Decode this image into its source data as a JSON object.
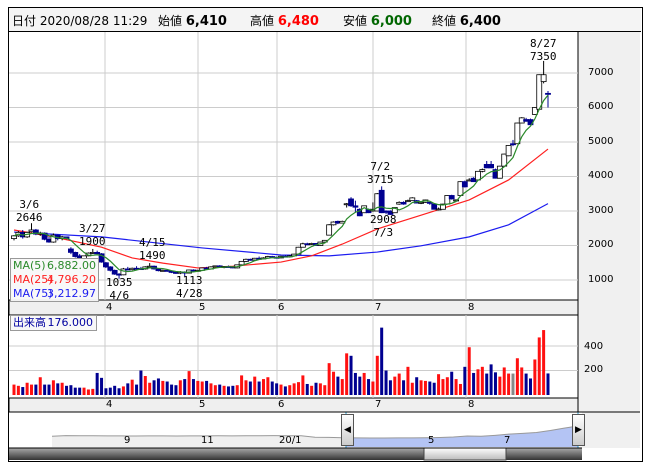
{
  "header": {
    "date_label": "日付",
    "date_value": "2020/08/28 11:29",
    "open_label": "始値",
    "open_value": "6,410",
    "high_label": "高値",
    "high_value": "6,480",
    "low_label": "安値",
    "low_value": "6,000",
    "close_label": "終値",
    "close_value": "6,400"
  },
  "legend": {
    "ma5_label": "MA(5)",
    "ma5_value": "6,882.00",
    "ma25_label": "MA(25)",
    "ma25_value": "4,796.20",
    "ma75_label": "MA(75)",
    "ma75_value": "3,212.97"
  },
  "volume_panel": {
    "label": "出来高",
    "value": "176.000",
    "ticks": [
      "400",
      "200"
    ]
  },
  "price_axis": {
    "ticks": [
      "7000",
      "6000",
      "5000",
      "4000",
      "3000",
      "2000",
      "1000"
    ]
  },
  "month_labels": [
    "4",
    "5",
    "6",
    "7",
    "8"
  ],
  "annotations": [
    {
      "date": "3/6",
      "value": "2646"
    },
    {
      "date": "3/27",
      "value": "1900"
    },
    {
      "date": "4/6",
      "value": "1035"
    },
    {
      "date": "4/15",
      "value": "1490"
    },
    {
      "date": "4/28",
      "value": "1113"
    },
    {
      "date": "7/2",
      "value": "3715"
    },
    {
      "date": "7/3",
      "value": "2908"
    },
    {
      "date": "8/27",
      "value": "7350"
    }
  ],
  "navigator": {
    "labels": [
      "9",
      "11",
      "20/1",
      "5",
      "7"
    ],
    "series": [
      2100,
      2350,
      2330,
      2300,
      2280,
      2250,
      2230,
      2250,
      2260,
      2240,
      2250,
      2280,
      2300,
      2260,
      2330,
      2320,
      2350,
      2340,
      2300,
      1700,
      1650,
      1500,
      1450,
      1400,
      1380,
      1420,
      1450,
      1500,
      1600,
      1800,
      2200,
      2100,
      2500,
      3000,
      3300,
      3700,
      4500,
      5500,
      6400
    ],
    "selected_from": 0.56
  },
  "colors": {
    "up_volume": "#ff1010",
    "down": "#000090",
    "ma5": "#2a8a2a",
    "ma25": "#ff2020",
    "ma75": "#1c1cf0",
    "nav_sel": "#b4c4f4"
  },
  "chart_data": {
    "type": "candlestick",
    "title": "",
    "price_ylim": [
      420,
      8130
    ],
    "volume_ylim": [
      0,
      645
    ],
    "month_start_index": {
      "4": 22,
      "5": 43,
      "6": 61,
      "7": 83,
      "8": 104
    },
    "ohlcv": [
      [
        2200,
        2300,
        2150,
        2280,
        85
      ],
      [
        2280,
        2420,
        2250,
        2380,
        75
      ],
      [
        2380,
        2450,
        2200,
        2250,
        65
      ],
      [
        2250,
        2400,
        2220,
        2380,
        100
      ],
      [
        2400,
        2646,
        2380,
        2450,
        85
      ],
      [
        2450,
        2480,
        2300,
        2330,
        85
      ],
      [
        2330,
        2400,
        2280,
        2360,
        145
      ],
      [
        2360,
        2380,
        2150,
        2180,
        85
      ],
      [
        2180,
        2250,
        2080,
        2100,
        85
      ],
      [
        2100,
        2350,
        2080,
        2300,
        120
      ],
      [
        2300,
        2320,
        2150,
        2200,
        95
      ],
      [
        2200,
        2280,
        2150,
        2250,
        100
      ],
      [
        2250,
        2260,
        2180,
        2200,
        75
      ],
      [
        1900,
        1950,
        1750,
        1800,
        80
      ],
      [
        1800,
        1820,
        1650,
        1680,
        60
      ],
      [
        1700,
        1750,
        1600,
        1620,
        60
      ],
      [
        1620,
        1700,
        1580,
        1700,
        60
      ],
      [
        1700,
        1800,
        1690,
        1780,
        45
      ],
      [
        1780,
        1900,
        1760,
        1800,
        50
      ],
      [
        1800,
        1850,
        1750,
        1760,
        180
      ],
      [
        1760,
        1780,
        1500,
        1520,
        140
      ],
      [
        1500,
        1520,
        1350,
        1380,
        55
      ],
      [
        1380,
        1400,
        1250,
        1280,
        60
      ],
      [
        1280,
        1300,
        1150,
        1170,
        75
      ],
      [
        1170,
        1200,
        1035,
        1150,
        55
      ],
      [
        1150,
        1350,
        1140,
        1320,
        70
      ],
      [
        1320,
        1380,
        1280,
        1300,
        95
      ],
      [
        1300,
        1360,
        1280,
        1340,
        125
      ],
      [
        1340,
        1400,
        1300,
        1330,
        85
      ],
      [
        1330,
        1380,
        1300,
        1320,
        200
      ],
      [
        1320,
        1400,
        1300,
        1380,
        155
      ],
      [
        1380,
        1490,
        1370,
        1400,
        100
      ],
      [
        1400,
        1420,
        1300,
        1320,
        120
      ],
      [
        1320,
        1340,
        1250,
        1270,
        135
      ],
      [
        1270,
        1300,
        1260,
        1280,
        115
      ],
      [
        1280,
        1300,
        1240,
        1260,
        110
      ],
      [
        1260,
        1280,
        1200,
        1220,
        85
      ],
      [
        1220,
        1250,
        1180,
        1200,
        80
      ],
      [
        1200,
        1260,
        1170,
        1230,
        120
      ],
      [
        1230,
        1250,
        1113,
        1200,
        130
      ],
      [
        1200,
        1300,
        1190,
        1290,
        195
      ],
      [
        1290,
        1310,
        1250,
        1260,
        130
      ],
      [
        1260,
        1300,
        1240,
        1280,
        115
      ],
      [
        1280,
        1360,
        1270,
        1350,
        110
      ],
      [
        1350,
        1380,
        1300,
        1320,
        115
      ],
      [
        1320,
        1400,
        1310,
        1380,
        95
      ],
      [
        1380,
        1420,
        1370,
        1410,
        80
      ],
      [
        1410,
        1430,
        1350,
        1370,
        85
      ],
      [
        1370,
        1400,
        1340,
        1390,
        75
      ],
      [
        1390,
        1420,
        1370,
        1380,
        70
      ],
      [
        1380,
        1400,
        1340,
        1350,
        75
      ],
      [
        1350,
        1450,
        1340,
        1440,
        80
      ],
      [
        1440,
        1550,
        1430,
        1540,
        160
      ],
      [
        1540,
        1620,
        1520,
        1600,
        120
      ],
      [
        1600,
        1620,
        1560,
        1580,
        110
      ],
      [
        1580,
        1640,
        1570,
        1630,
        150
      ],
      [
        1630,
        1680,
        1600,
        1620,
        110
      ],
      [
        1620,
        1660,
        1600,
        1640,
        130
      ],
      [
        1640,
        1700,
        1630,
        1680,
        145
      ],
      [
        1680,
        1700,
        1650,
        1660,
        110
      ],
      [
        1660,
        1680,
        1620,
        1640,
        95
      ],
      [
        1640,
        1700,
        1630,
        1690,
        85
      ],
      [
        1690,
        1720,
        1660,
        1670,
        70
      ],
      [
        1670,
        1720,
        1650,
        1700,
        80
      ],
      [
        1700,
        1760,
        1690,
        1750,
        95
      ],
      [
        1750,
        1960,
        1740,
        1950,
        105
      ],
      [
        1950,
        2080,
        1940,
        2050,
        160
      ],
      [
        2050,
        2080,
        2020,
        2040,
        90
      ],
      [
        2040,
        2080,
        2020,
        2060,
        75
      ],
      [
        2060,
        2070,
        1990,
        2000,
        100
      ],
      [
        2000,
        2110,
        1990,
        2100,
        95
      ],
      [
        2100,
        2160,
        2080,
        2150,
        80
      ],
      [
        2300,
        2620,
        2290,
        2600,
        260
      ],
      [
        2600,
        2700,
        2580,
        2680,
        190
      ],
      [
        2700,
        2720,
        2620,
        2650,
        150
      ],
      [
        2650,
        2720,
        2640,
        2700,
        130
      ],
      [
        3200,
        3230,
        3100,
        3210,
        340
      ],
      [
        3350,
        3400,
        3120,
        3150,
        320
      ],
      [
        3150,
        3300,
        2950,
        3110,
        180
      ],
      [
        3050,
        3080,
        2850,
        2860,
        150
      ],
      [
        2950,
        3160,
        2940,
        3150,
        180
      ],
      [
        3050,
        3070,
        2940,
        2950,
        130
      ],
      [
        3000,
        3250,
        2980,
        3050,
        110
      ],
      [
        3000,
        3520,
        2990,
        3500,
        320
      ],
      [
        3600,
        3715,
        2940,
        2950,
        550
      ],
      [
        3000,
        3020,
        2908,
        2960,
        200
      ],
      [
        3000,
        3020,
        2890,
        2900,
        120
      ],
      [
        2950,
        3110,
        2940,
        3100,
        150
      ],
      [
        3200,
        3280,
        3180,
        3250,
        175
      ],
      [
        3250,
        3280,
        3180,
        3200,
        120
      ],
      [
        3280,
        3330,
        3260,
        3300,
        230
      ],
      [
        3300,
        3400,
        3290,
        3380,
        100
      ],
      [
        3300,
        3320,
        3220,
        3230,
        145
      ],
      [
        3230,
        3280,
        3200,
        3250,
        120
      ],
      [
        3250,
        3330,
        3240,
        3320,
        115
      ],
      [
        3250,
        3270,
        3180,
        3240,
        110
      ],
      [
        3200,
        3210,
        3040,
        3050,
        100
      ],
      [
        3050,
        3100,
        3020,
        3060,
        170
      ],
      [
        3050,
        3210,
        3040,
        3200,
        130
      ],
      [
        3200,
        3460,
        3190,
        3450,
        145
      ],
      [
        3450,
        3470,
        3330,
        3350,
        190
      ],
      [
        3300,
        3340,
        3260,
        3320,
        130
      ],
      [
        3450,
        3860,
        3440,
        3850,
        90
      ],
      [
        3850,
        3880,
        3680,
        3700,
        230
      ],
      [
        3880,
        3950,
        3860,
        3900,
        390
      ],
      [
        3950,
        3980,
        3840,
        3850,
        180
      ],
      [
        3900,
        4160,
        3890,
        4150,
        210
      ],
      [
        4150,
        4230,
        4120,
        4200,
        230
      ],
      [
        4350,
        4450,
        4240,
        4250,
        175
      ],
      [
        4350,
        4450,
        4240,
        4250,
        250
      ],
      [
        4200,
        4230,
        3940,
        3950,
        185
      ],
      [
        3950,
        4310,
        3940,
        4300,
        150
      ],
      [
        4300,
        4660,
        4290,
        4650,
        225
      ],
      [
        4600,
        4910,
        4590,
        4900,
        175
      ],
      [
        4950,
        5060,
        4880,
        4950,
        175
      ],
      [
        4950,
        5560,
        4940,
        5550,
        300
      ],
      [
        5550,
        5720,
        5540,
        5700,
        225
      ],
      [
        5650,
        5700,
        5590,
        5600,
        175
      ],
      [
        5650,
        5680,
        5490,
        5500,
        135
      ],
      [
        5800,
        6010,
        5790,
        6000,
        290
      ],
      [
        5950,
        6960,
        5940,
        6950,
        470
      ],
      [
        6750,
        7350,
        6700,
        6950,
        530
      ],
      [
        6410,
        6480,
        6000,
        6400,
        176
      ]
    ],
    "ma75_points": [
      [
        0,
        2390
      ],
      [
        20,
        2250
      ],
      [
        43,
        1930
      ],
      [
        61,
        1725
      ],
      [
        72,
        1700
      ],
      [
        83,
        1810
      ],
      [
        93,
        1990
      ],
      [
        104,
        2250
      ],
      [
        113,
        2600
      ],
      [
        122,
        3213
      ]
    ],
    "ma25_points": [
      [
        0,
        2450
      ],
      [
        9,
        2250
      ],
      [
        20,
        1950
      ],
      [
        27,
        1640
      ],
      [
        34,
        1490
      ],
      [
        42,
        1350
      ],
      [
        50,
        1400
      ],
      [
        61,
        1520
      ],
      [
        68,
        1700
      ],
      [
        75,
        2040
      ],
      [
        83,
        2480
      ],
      [
        93,
        2880
      ],
      [
        104,
        3320
      ],
      [
        113,
        3900
      ],
      [
        122,
        4796
      ]
    ]
  }
}
